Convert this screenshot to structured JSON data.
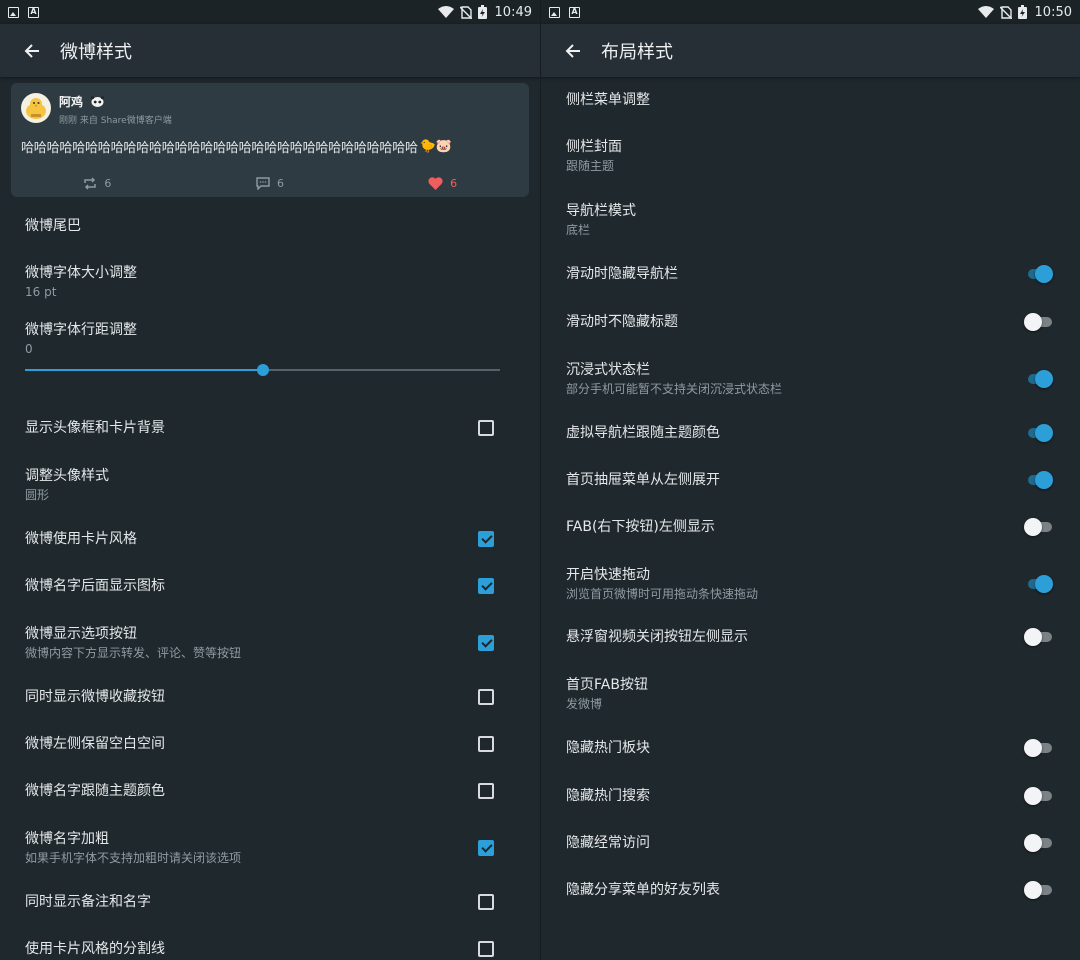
{
  "left": {
    "status": {
      "time": "10:49"
    },
    "appbar": {
      "title": "微博样式"
    },
    "preview": {
      "name": "阿鸡",
      "time": "刚刚",
      "source": "来自 Share微博客户端",
      "text": "哈哈哈哈哈哈哈哈哈哈哈哈哈哈哈哈哈哈哈哈哈哈哈哈哈哈哈哈哈哈哈",
      "emoji": [
        "🐤",
        "🐷"
      ],
      "reposts": "6",
      "comments": "6",
      "likes": "6"
    },
    "items": [
      {
        "title": "微博尾巴"
      },
      {
        "title": "微博字体大小调整",
        "sub": "16 pt"
      },
      {
        "title": "微博字体行距调整",
        "sub": "0"
      },
      {
        "title": "显示头像框和卡片背景",
        "checked": false
      },
      {
        "title": "调整头像样式",
        "sub": "圆形"
      },
      {
        "title": "微博使用卡片风格",
        "checked": true
      },
      {
        "title": "微博名字后面显示图标",
        "checked": true
      },
      {
        "title": "微博显示选项按钮",
        "sub": "微博内容下方显示转发、评论、赞等按钮",
        "checked": true
      },
      {
        "title": "同时显示微博收藏按钮",
        "checked": false
      },
      {
        "title": "微博左侧保留空白空间",
        "checked": false
      },
      {
        "title": "微博名字跟随主题颜色",
        "checked": false
      },
      {
        "title": "微博名字加粗",
        "sub": "如果手机字体不支持加粗时请关闭该选项",
        "checked": true
      },
      {
        "title": "同时显示备注和名字",
        "checked": false
      },
      {
        "title": "使用卡片风格的分割线",
        "checked": false
      }
    ],
    "line_spacing_slider": {
      "fraction": 0.5
    }
  },
  "right": {
    "status": {
      "time": "10:50"
    },
    "appbar": {
      "title": "布局样式"
    },
    "items": [
      {
        "title": "侧栏菜单调整"
      },
      {
        "title": "侧栏封面",
        "sub": "跟随主题"
      },
      {
        "title": "导航栏模式",
        "sub": "底栏"
      },
      {
        "title": "滑动时隐藏导航栏",
        "on": true
      },
      {
        "title": "滑动时不隐藏标题",
        "on": false
      },
      {
        "title": "沉浸式状态栏",
        "sub": "部分手机可能暂不支持关闭沉浸式状态栏",
        "on": true
      },
      {
        "title": "虚拟导航栏跟随主题颜色",
        "on": true
      },
      {
        "title": "首页抽屉菜单从左侧展开",
        "on": true
      },
      {
        "title": "FAB(右下按钮)左侧显示",
        "on": false
      },
      {
        "title": "开启快速拖动",
        "sub": "浏览首页微博时可用拖动条快速拖动",
        "on": true
      },
      {
        "title": "悬浮窗视频关闭按钮左侧显示",
        "on": false
      },
      {
        "title": "首页FAB按钮",
        "sub": "发微博"
      },
      {
        "title": "隐藏热门板块",
        "on": false
      },
      {
        "title": "隐藏热门搜索",
        "on": false
      },
      {
        "title": "隐藏经常访问",
        "on": false
      },
      {
        "title": "隐藏分享菜单的好友列表",
        "on": false
      }
    ]
  },
  "icons": {
    "status_left": [
      "image-icon",
      "text-app-icon"
    ],
    "status_right": [
      "wifi-icon",
      "no-sim-icon",
      "battery-charging-icon"
    ],
    "back": "arrow-left-icon",
    "repost": "repost-icon",
    "comment": "comment-icon",
    "like": "heart-icon"
  },
  "colors": {
    "accent": "#2c9fd9",
    "like": "#ef5e5e",
    "background": "#1f282d",
    "appbar": "#252f35",
    "card": "#2f3b42"
  }
}
